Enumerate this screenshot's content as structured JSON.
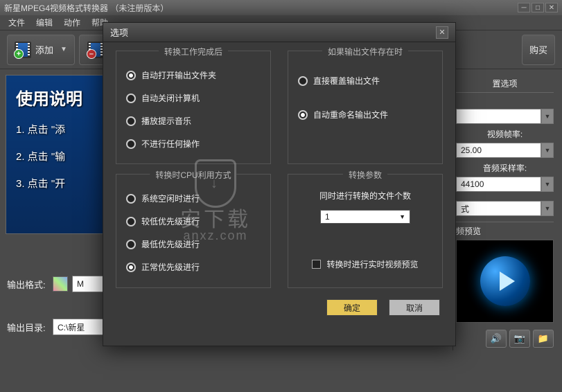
{
  "window": {
    "title": "新星MPEG4视频格式转换器 （未注册版本）"
  },
  "menu": [
    "文件",
    "编辑",
    "动作",
    "帮助"
  ],
  "toolbar": {
    "add_label": "添加",
    "buy_label": "购买"
  },
  "instructions": {
    "title": "使用说明",
    "step1": "1. 点击 \"添",
    "step2": "2. 点击 \"输",
    "step3": "3. 点击 \"开"
  },
  "output": {
    "format_label": "输出格式:",
    "format_value": "M",
    "dir_label": "输出目录:",
    "dir_value": "C:\\新星"
  },
  "config": {
    "panel_title": "置选项",
    "fps_label": "视频帧率:",
    "fps_value": "25.00",
    "sample_label": "音频采样率:",
    "sample_value": "44100",
    "ext_value": "式",
    "preview_title": "频预览"
  },
  "modal": {
    "title": "选项",
    "group1": {
      "legend": "转换工作完成后",
      "opt1": "自动打开输出文件夹",
      "opt2": "自动关闭计算机",
      "opt3": "播放提示音乐",
      "opt4": "不进行任何操作"
    },
    "group2": {
      "legend": "如果输出文件存在时",
      "opt1": "直接覆盖输出文件",
      "opt2": "自动重命名输出文件"
    },
    "group3": {
      "legend": "转换时CPU利用方式",
      "opt1": "系统空闲时进行",
      "opt2": "较低优先级进行",
      "opt3": "最低优先级进行",
      "opt4": "正常优先级进行"
    },
    "group4": {
      "legend": "转换参数",
      "concurrent_label": "同时进行转换的文件个数",
      "concurrent_value": "1",
      "preview_check": "转换时进行实时视频预览"
    },
    "ok": "确定",
    "cancel": "取消"
  },
  "watermark": {
    "name": "安下载",
    "url": "anxz.com"
  }
}
